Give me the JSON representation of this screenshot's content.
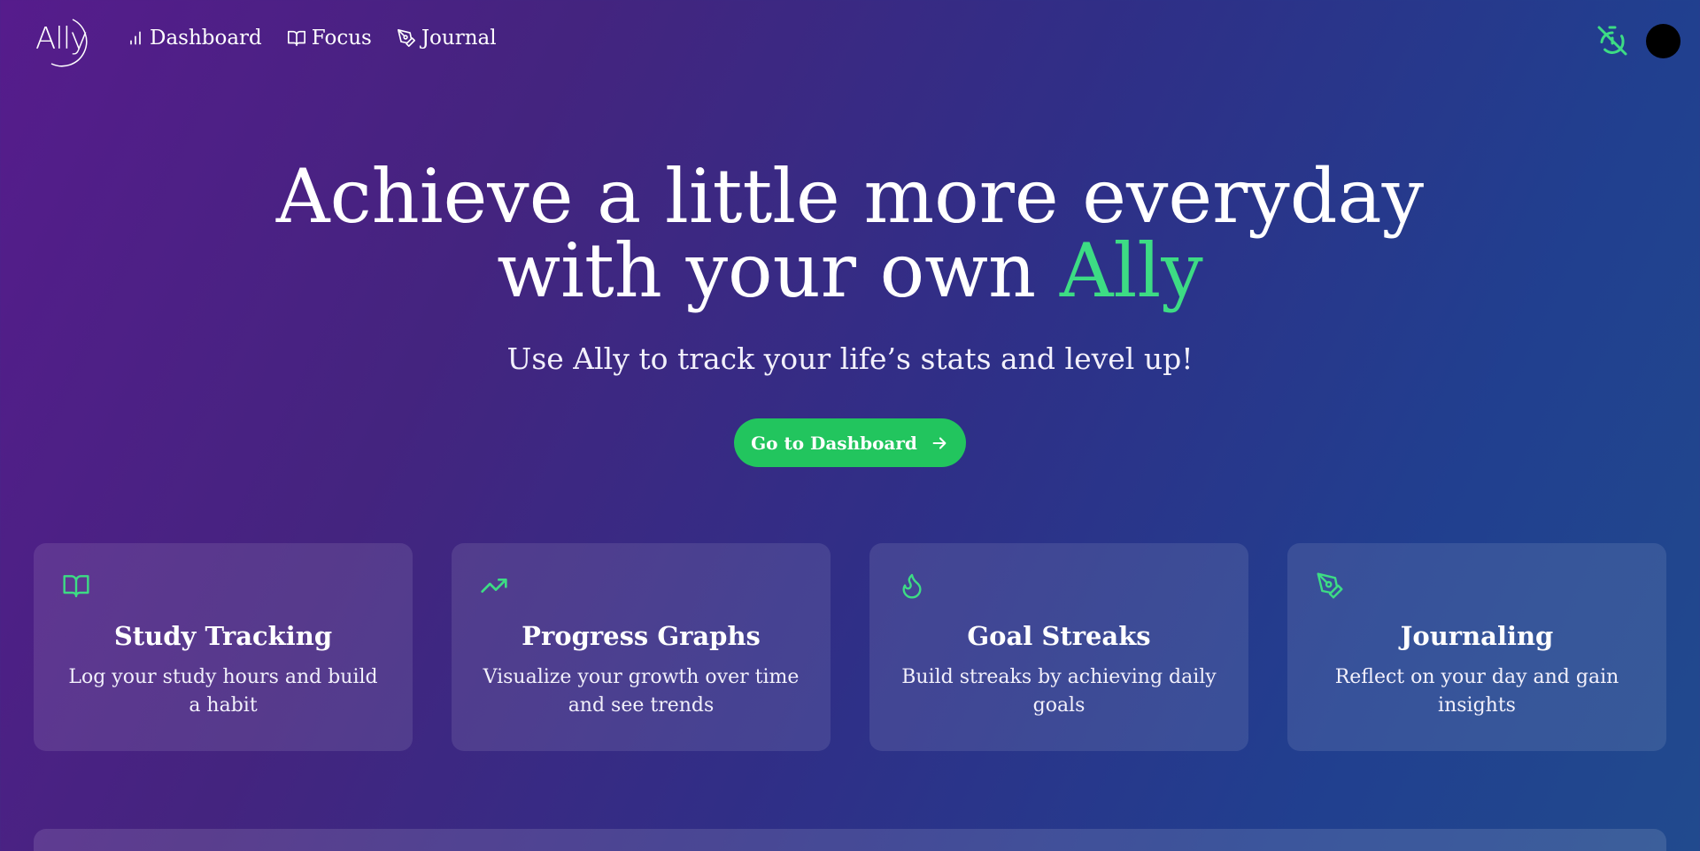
{
  "brand": {
    "logo_text": "Ally",
    "accent_color": "#3ddc84",
    "button_color": "#22c55e"
  },
  "nav": {
    "links": [
      {
        "label": "Dashboard",
        "icon": "bar-chart-icon"
      },
      {
        "label": "Focus",
        "icon": "book-open-icon"
      },
      {
        "label": "Journal",
        "icon": "pen-tool-icon"
      }
    ],
    "timer_icon": "timer-off-icon",
    "avatar_color": "#000000"
  },
  "hero": {
    "title_line1": "Achieve a little more everyday",
    "title_line2_prefix": "with your own ",
    "title_line2_accent": "Ally",
    "subtitle": "Use Ally to track your life’s stats and level up!",
    "cta_label": "Go to Dashboard",
    "cta_icon": "arrow-right-icon"
  },
  "features": [
    {
      "icon": "book-open-icon",
      "title": "Study Tracking",
      "description": "Log your study hours and build a habit"
    },
    {
      "icon": "trending-up-icon",
      "title": "Progress Graphs",
      "description": "Visualize your growth over time and see trends"
    },
    {
      "icon": "flame-icon",
      "title": "Goal Streaks",
      "description": "Build streaks by achieving daily goals"
    },
    {
      "icon": "pen-tool-icon",
      "title": "Journaling",
      "description": "Reflect on your day and gain insights"
    }
  ]
}
